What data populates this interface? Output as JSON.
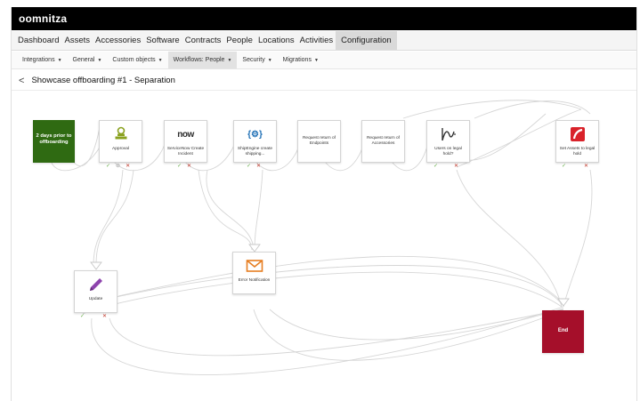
{
  "brand": {
    "name": "oomnitza"
  },
  "main_nav": {
    "items": [
      "Dashboard",
      "Assets",
      "Accessories",
      "Software",
      "Contracts",
      "People",
      "Locations",
      "Activities",
      "Configuration"
    ],
    "active": "Configuration"
  },
  "sub_nav": {
    "items": [
      "Integrations",
      "General",
      "Custom objects",
      "Workflows: People",
      "Security",
      "Migrations"
    ],
    "active": "Workflows: People"
  },
  "page": {
    "back_glyph": "<",
    "title": "Showcase offboarding #1 - Separation"
  },
  "nodes": {
    "start": {
      "label": "2 days prior to offboarding"
    },
    "approval": {
      "label": "Approval",
      "icon": "stamp-icon"
    },
    "servicenow": {
      "label": "ServiceNow Create Incident",
      "icon_text": "now",
      "icon": "servicenow-logo"
    },
    "shipengine": {
      "label": "ShipEngine create shipping...",
      "icon_text": "{⚙}",
      "icon": "shipengine-logo"
    },
    "endpoints": {
      "label": "Request return of Endpoints"
    },
    "accessories": {
      "label": "Request return of Accessories"
    },
    "legal_hold_check": {
      "label": "Users on legal hold?",
      "icon": "branch-icon"
    },
    "set_legal_hold": {
      "label": "Set Assets to legal hold",
      "icon": "assets-logo"
    },
    "update": {
      "label": "Update",
      "icon": "pencil-icon"
    },
    "error_notification": {
      "label": "Error Notification",
      "icon": "envelope-icon"
    },
    "end": {
      "label": "End"
    }
  },
  "ports": {
    "ok": "✓",
    "neutral": "⊘",
    "fail": "✕"
  },
  "colors": {
    "start": "#2f6a12",
    "end": "#a50f2a",
    "ok": "#6ab04c",
    "fail": "#c0392b",
    "approval_icon": "#8aa11f",
    "update_icon": "#8e44ad",
    "error_icon": "#e67e22",
    "assets_icon": "#d9222a"
  }
}
